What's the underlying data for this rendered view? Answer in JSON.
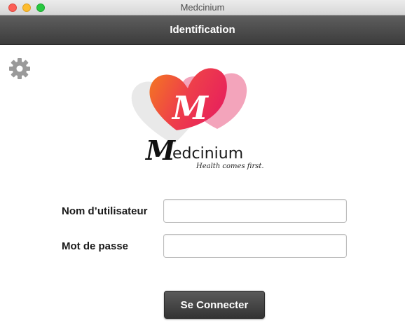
{
  "window": {
    "title": "Medcinium"
  },
  "header": {
    "title": "Identification"
  },
  "toolbar": {
    "settings_icon": "gear-icon"
  },
  "logo": {
    "brand_initial": "M",
    "brand_rest": "edcinium",
    "tagline": "Health comes first.",
    "colors": {
      "heart_front": "#e8245a",
      "heart_orange": "#f47a1f",
      "heart_back": "#f29ab4"
    }
  },
  "form": {
    "username_label": "Nom d’utilisateur",
    "username_value": "",
    "password_label": "Mot de passe",
    "password_value": "",
    "submit_label": "Se Connecter"
  }
}
